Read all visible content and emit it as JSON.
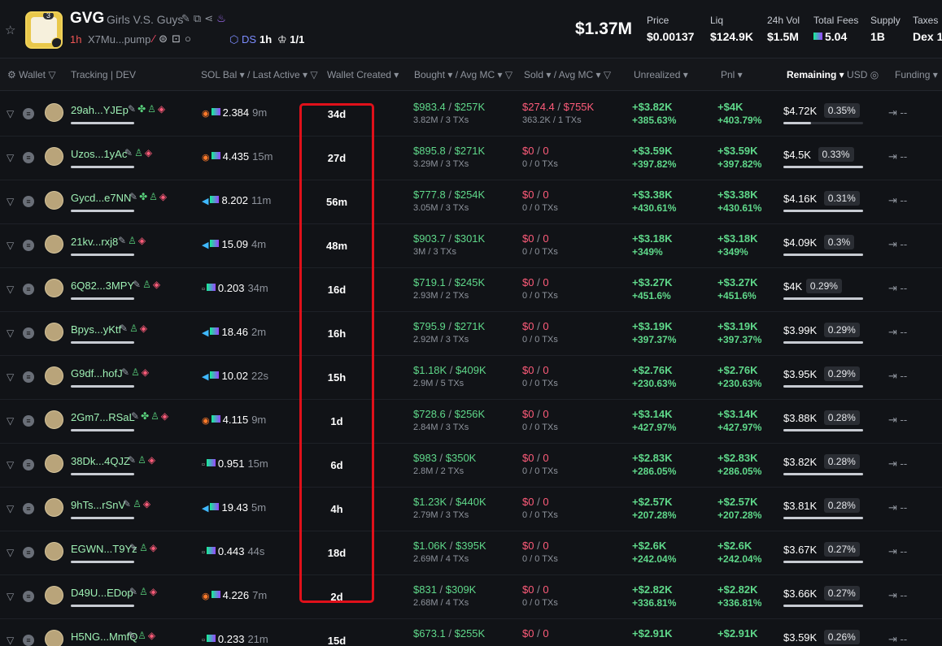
{
  "token": {
    "symbol": "GVG",
    "name": "Girls V.S. Guys",
    "logo_badge": "3",
    "age": "1h",
    "address": "X7Mu...pump",
    "ds_label": "DS",
    "ds_age": "1h",
    "holders": "1/1",
    "market_cap": "$1.37M"
  },
  "stats": [
    {
      "label": "Price",
      "value": "$0.00137"
    },
    {
      "label": "Liq",
      "value": "$124.9K"
    },
    {
      "label": "24h Vol",
      "value": "$1.5M"
    },
    {
      "label": "Total Fees",
      "value": "5.04"
    },
    {
      "label": "Supply",
      "value": "1B"
    },
    {
      "label": "Taxes",
      "value": "Dex 1"
    }
  ],
  "columns": {
    "wallet": "Wallet",
    "tracking": "Tracking",
    "dev": "DEV",
    "sol_bal": "SOL Bal",
    "last_active": "Last Active",
    "wallet_created": "Wallet Created",
    "bought": "Bought",
    "avg_mc_buy": "Avg MC",
    "sold": "Sold",
    "avg_mc_sell": "Avg MC",
    "unrealized": "Unrealized",
    "pnl": "Pnl",
    "remaining": "Remaining",
    "usd": "USD",
    "funding": "Funding"
  },
  "colors": {
    "highlight": "#e0101a",
    "positive": "#5fd88a",
    "negative": "#ff5c7a"
  },
  "rows": [
    {
      "wallet": "29ah...YJEp",
      "sol": "2.384",
      "last": "9m",
      "created": "34d",
      "bought": "$983.4",
      "bought_mc": "$257K",
      "bought_sub": "3.82M / 3 TXs",
      "sold": "$274.4",
      "sold_mc": "$755K",
      "sold_sub": "363.2K / 1 TXs",
      "unreal": "+$3.82K",
      "unreal_pct": "+385.63%",
      "pnl": "+$4K",
      "pnl_pct": "+403.79%",
      "remaining": "$4.72K",
      "rem_pct": "0.35%",
      "rem_frac": 0.35,
      "funding": "--"
    },
    {
      "wallet": "Uzos...1yAc",
      "sol": "4.435",
      "last": "15m",
      "created": "27d",
      "bought": "$895.8",
      "bought_mc": "$271K",
      "bought_sub": "3.29M / 3 TXs",
      "sold": "$0",
      "sold_mc": "0",
      "sold_sub": "0 / 0 TXs",
      "unreal": "+$3.59K",
      "unreal_pct": "+397.82%",
      "pnl": "+$3.59K",
      "pnl_pct": "+397.82%",
      "remaining": "$4.5K",
      "rem_pct": "0.33%",
      "rem_frac": 1,
      "funding": "--"
    },
    {
      "wallet": "Gycd...e7NN",
      "sol": "8.202",
      "last": "11m",
      "created": "56m",
      "bought": "$777.8",
      "bought_mc": "$254K",
      "bought_sub": "3.05M / 3 TXs",
      "sold": "$0",
      "sold_mc": "0",
      "sold_sub": "0 / 0 TXs",
      "unreal": "+$3.38K",
      "unreal_pct": "+430.61%",
      "pnl": "+$3.38K",
      "pnl_pct": "+430.61%",
      "remaining": "$4.16K",
      "rem_pct": "0.31%",
      "rem_frac": 1,
      "funding": "--"
    },
    {
      "wallet": "21kv...rxj8",
      "sol": "15.09",
      "last": "4m",
      "created": "48m",
      "bought": "$903.7",
      "bought_mc": "$301K",
      "bought_sub": "3M / 3 TXs",
      "sold": "$0",
      "sold_mc": "0",
      "sold_sub": "0 / 0 TXs",
      "unreal": "+$3.18K",
      "unreal_pct": "+349%",
      "pnl": "+$3.18K",
      "pnl_pct": "+349%",
      "remaining": "$4.09K",
      "rem_pct": "0.3%",
      "rem_frac": 1,
      "funding": "--"
    },
    {
      "wallet": "6Q82...3MPY",
      "sol": "0.203",
      "last": "34m",
      "created": "16d",
      "bought": "$719.1",
      "bought_mc": "$245K",
      "bought_sub": "2.93M / 2 TXs",
      "sold": "$0",
      "sold_mc": "0",
      "sold_sub": "0 / 0 TXs",
      "unreal": "+$3.27K",
      "unreal_pct": "+451.6%",
      "pnl": "+$3.27K",
      "pnl_pct": "+451.6%",
      "remaining": "$4K",
      "rem_pct": "0.29%",
      "rem_frac": 1,
      "funding": "--"
    },
    {
      "wallet": "Bpys...yKtf",
      "sol": "18.46",
      "last": "2m",
      "created": "16h",
      "bought": "$795.9",
      "bought_mc": "$271K",
      "bought_sub": "2.92M / 3 TXs",
      "sold": "$0",
      "sold_mc": "0",
      "sold_sub": "0 / 0 TXs",
      "unreal": "+$3.19K",
      "unreal_pct": "+397.37%",
      "pnl": "+$3.19K",
      "pnl_pct": "+397.37%",
      "remaining": "$3.99K",
      "rem_pct": "0.29%",
      "rem_frac": 1,
      "funding": "--"
    },
    {
      "wallet": "G9df...hofJ",
      "sol": "10.02",
      "last": "22s",
      "created": "15h",
      "bought": "$1.18K",
      "bought_mc": "$409K",
      "bought_sub": "2.9M / 5 TXs",
      "sold": "$0",
      "sold_mc": "0",
      "sold_sub": "0 / 0 TXs",
      "unreal": "+$2.76K",
      "unreal_pct": "+230.63%",
      "pnl": "+$2.76K",
      "pnl_pct": "+230.63%",
      "remaining": "$3.95K",
      "rem_pct": "0.29%",
      "rem_frac": 1,
      "funding": "--"
    },
    {
      "wallet": "2Gm7...RSaL",
      "sol": "4.115",
      "last": "9m",
      "created": "1d",
      "bought": "$728.6",
      "bought_mc": "$256K",
      "bought_sub": "2.84M / 3 TXs",
      "sold": "$0",
      "sold_mc": "0",
      "sold_sub": "0 / 0 TXs",
      "unreal": "+$3.14K",
      "unreal_pct": "+427.97%",
      "pnl": "+$3.14K",
      "pnl_pct": "+427.97%",
      "remaining": "$3.88K",
      "rem_pct": "0.28%",
      "rem_frac": 1,
      "funding": "--"
    },
    {
      "wallet": "38Dk...4QJZ",
      "sol": "0.951",
      "last": "15m",
      "created": "6d",
      "bought": "$983",
      "bought_mc": "$350K",
      "bought_sub": "2.8M / 2 TXs",
      "sold": "$0",
      "sold_mc": "0",
      "sold_sub": "0 / 0 TXs",
      "unreal": "+$2.83K",
      "unreal_pct": "+286.05%",
      "pnl": "+$2.83K",
      "pnl_pct": "+286.05%",
      "remaining": "$3.82K",
      "rem_pct": "0.28%",
      "rem_frac": 1,
      "funding": "--"
    },
    {
      "wallet": "9hTs...rSnV",
      "sol": "19.43",
      "last": "5m",
      "created": "4h",
      "bought": "$1.23K",
      "bought_mc": "$440K",
      "bought_sub": "2.79M / 3 TXs",
      "sold": "$0",
      "sold_mc": "0",
      "sold_sub": "0 / 0 TXs",
      "unreal": "+$2.57K",
      "unreal_pct": "+207.28%",
      "pnl": "+$2.57K",
      "pnl_pct": "+207.28%",
      "remaining": "$3.81K",
      "rem_pct": "0.28%",
      "rem_frac": 1,
      "funding": "--"
    },
    {
      "wallet": "EGWN...T9Yz",
      "sol": "0.443",
      "last": "44s",
      "created": "18d",
      "bought": "$1.06K",
      "bought_mc": "$395K",
      "bought_sub": "2.69M / 4 TXs",
      "sold": "$0",
      "sold_mc": "0",
      "sold_sub": "0 / 0 TXs",
      "unreal": "+$2.6K",
      "unreal_pct": "+242.04%",
      "pnl": "+$2.6K",
      "pnl_pct": "+242.04%",
      "remaining": "$3.67K",
      "rem_pct": "0.27%",
      "rem_frac": 1,
      "funding": "--"
    },
    {
      "wallet": "D49U...EDop",
      "sol": "4.226",
      "last": "7m",
      "created": "2d",
      "bought": "$831",
      "bought_mc": "$309K",
      "bought_sub": "2.68M / 4 TXs",
      "sold": "$0",
      "sold_mc": "0",
      "sold_sub": "0 / 0 TXs",
      "unreal": "+$2.82K",
      "unreal_pct": "+336.81%",
      "pnl": "+$2.82K",
      "pnl_pct": "+336.81%",
      "remaining": "$3.66K",
      "rem_pct": "0.27%",
      "rem_frac": 1,
      "funding": "--"
    },
    {
      "wallet": "H5NG...MmfQ",
      "sol": "0.233",
      "last": "21m",
      "created": "15d",
      "bought": "$673.1",
      "bought_mc": "$255K",
      "bought_sub": "",
      "sold": "$0",
      "sold_mc": "0",
      "sold_sub": "",
      "unreal": "+$2.91K",
      "unreal_pct": "",
      "pnl": "+$2.91K",
      "pnl_pct": "",
      "remaining": "$3.59K",
      "rem_pct": "0.26%",
      "rem_frac": 1,
      "funding": "--"
    }
  ]
}
